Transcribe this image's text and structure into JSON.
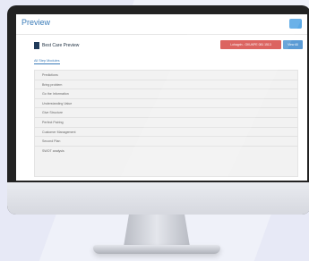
{
  "app": {
    "title": "Preview",
    "doc_title": "Best Care Preview",
    "red_button_label": "Lohagrin - GKUKPE 081 1513",
    "blue_button_label": "View All",
    "breadcrumb": "All Step Modules"
  },
  "list": {
    "items": [
      {
        "label": "Predictions"
      },
      {
        "label": "Bring problem"
      },
      {
        "label": "Go the Information"
      },
      {
        "label": "Understanding Value"
      },
      {
        "label": "Give Structure"
      },
      {
        "label": "Perfect Pairing"
      },
      {
        "label": "Customer Management"
      },
      {
        "label": "Second Plan"
      },
      {
        "label": "SWOT analysis"
      }
    ]
  }
}
